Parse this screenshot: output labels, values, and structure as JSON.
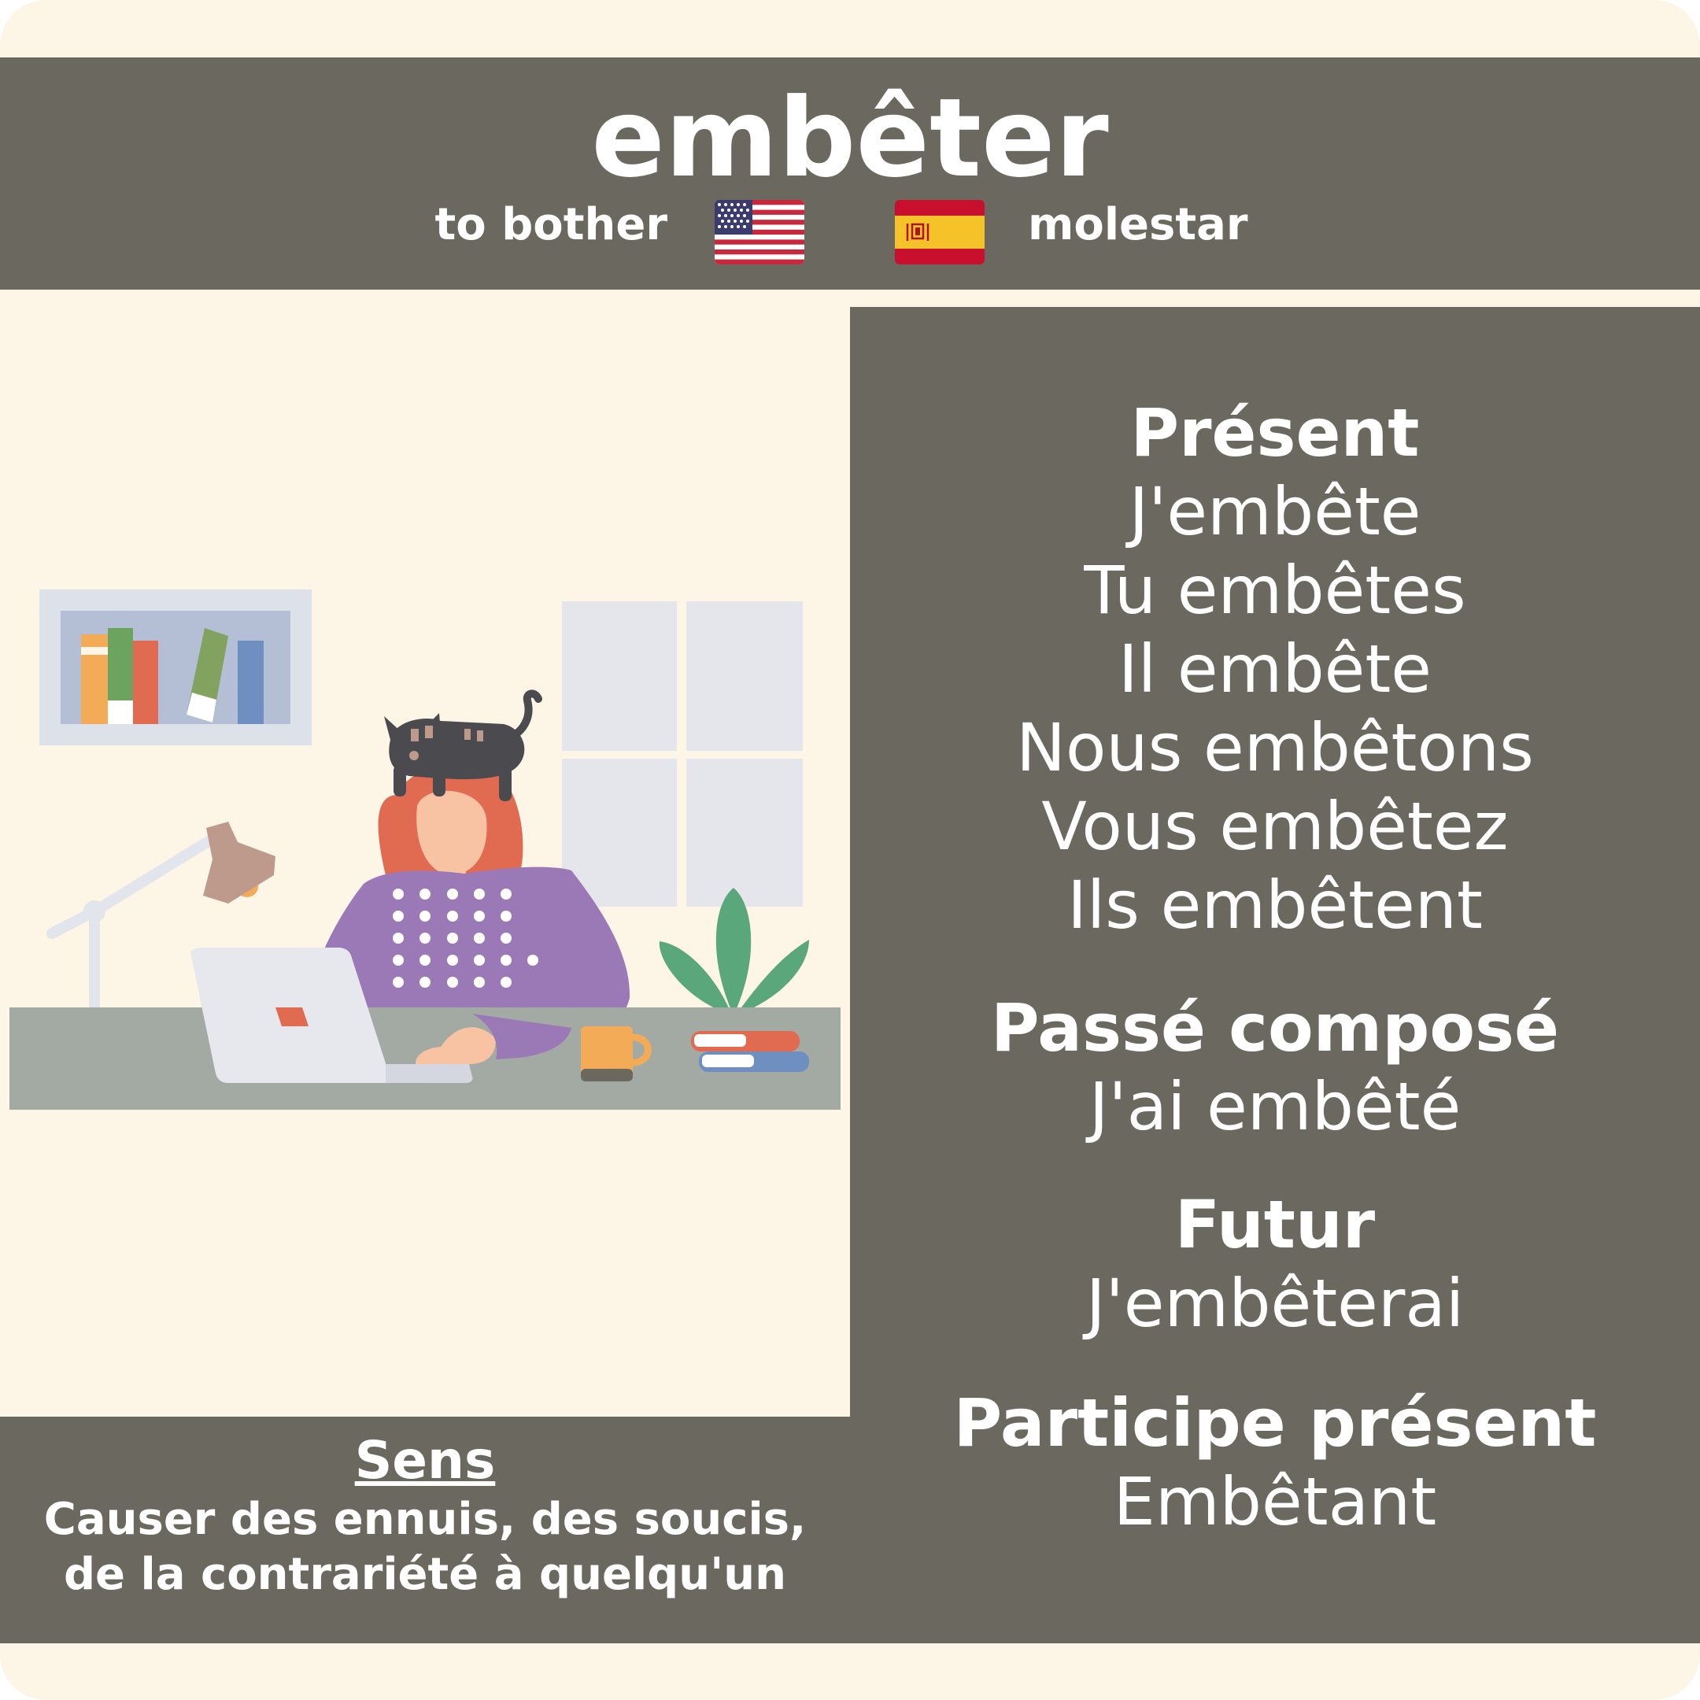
{
  "header": {
    "verb": "embêter",
    "translation_en": "to bother",
    "translation_es": "molestar"
  },
  "conjugation": {
    "present": {
      "label": "Présent",
      "forms": [
        "J'embête",
        "Tu embêtes",
        "Il embête",
        "Nous embêtons",
        "Vous embêtez",
        "Ils embêtent"
      ]
    },
    "passe_compose": {
      "label": "Passé composé",
      "form": "J'ai embêté"
    },
    "futur": {
      "label": "Futur",
      "form": "J'embêterai"
    },
    "participe_present": {
      "label": "Participe présent",
      "form": "Embêtant"
    }
  },
  "meaning": {
    "title": "Sens",
    "lines": [
      "Causer des ennuis, des soucis,",
      "de la contrariété à quelqu'un"
    ]
  },
  "icons": {
    "flag_en": "us-flag-icon",
    "flag_es": "spain-flag-icon"
  },
  "colors": {
    "background": "#fdf5e6",
    "panel": "#6b6860",
    "text": "#ffffff"
  }
}
